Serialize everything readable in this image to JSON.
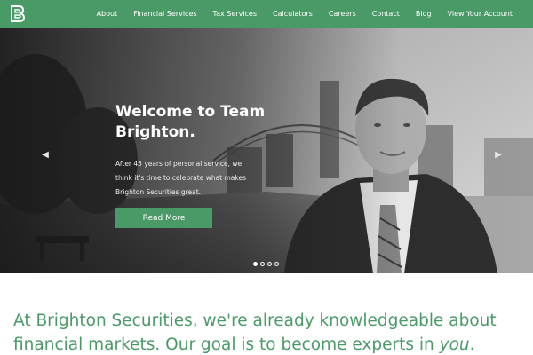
{
  "brand": {
    "logo_letter": "B",
    "accent_color": "#4a9a67"
  },
  "nav": {
    "items": [
      {
        "label": "About"
      },
      {
        "label": "Financial Services"
      },
      {
        "label": "Tax Services"
      },
      {
        "label": "Calculators"
      },
      {
        "label": "Careers"
      },
      {
        "label": "Contact"
      },
      {
        "label": "Blog"
      },
      {
        "label": "View Your Account"
      }
    ]
  },
  "hero": {
    "title": "Welcome to Team Brighton.",
    "text": "After 45 years of personal service, we think it's time to celebrate what makes Brighton Securities great.",
    "button_label": "Read More",
    "prev_icon": "chevron-left-icon",
    "next_icon": "chevron-right-icon",
    "slide_count": 4,
    "active_slide": 1
  },
  "intro": {
    "text_before": "At Brighton Securities, we're already knowledgeable about financial markets. Our goal is to become experts in ",
    "emphasis": "you",
    "text_after": "."
  }
}
